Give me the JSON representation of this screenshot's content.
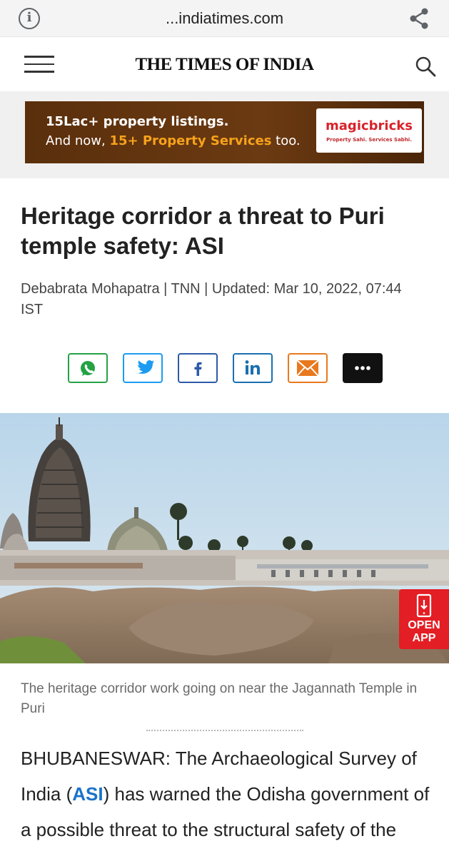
{
  "browser": {
    "domain": "...indiatimes.com",
    "info_symbol": "i"
  },
  "header": {
    "logo": "THE TIMES OF INDIA"
  },
  "ad": {
    "line1": "15Lac+ property listings.",
    "line2_prefix": "And now, ",
    "line2_highlight": "15+ Property Services",
    "line2_suffix": " too.",
    "brand": "magicbricks",
    "brand_tagline": "Property Sahi. Services Sabhi.",
    "colors": {
      "background": "#5a2f0c",
      "highlight": "#f7a21b",
      "brand": "#d8232a"
    }
  },
  "article": {
    "headline": "Heritage corridor a threat to Puri temple safety: ASI",
    "byline": "Debabrata Mohapatra | TNN | Updated: Mar 10, 2022, 07:44 IST",
    "caption": "The heritage corridor work going on near the Jagannath Temple in Puri",
    "body_prefix": "BHUBANESWAR: The Archaeological Survey of India (",
    "body_link": "ASI",
    "body_suffix": ") has warned the Odisha government of a possible threat to the structural safety of the Jagannath"
  },
  "share_buttons": [
    {
      "name": "whatsapp",
      "icon": "whatsapp-icon",
      "color": "#25a244"
    },
    {
      "name": "twitter",
      "icon": "twitter-icon",
      "color": "#1d9bf0"
    },
    {
      "name": "facebook",
      "icon": "facebook-icon",
      "color": "#2d5aa8"
    },
    {
      "name": "linkedin",
      "icon": "linkedin-icon",
      "color": "#1a6fb0"
    },
    {
      "name": "email",
      "icon": "email-icon",
      "color": "#e8791e"
    },
    {
      "name": "more",
      "icon": "more-icon",
      "color": "#111111"
    }
  ],
  "open_app": {
    "label_line1": "OPEN",
    "label_line2": "APP",
    "color": "#e31e24"
  }
}
